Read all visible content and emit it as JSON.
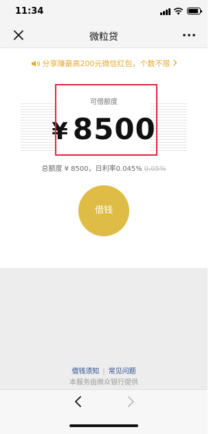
{
  "status_bar": {
    "time": "11:34"
  },
  "nav": {
    "title": "微粒贷",
    "close_icon": "close-icon",
    "more_icon": "more-dots-icon"
  },
  "promo": {
    "text": "分享赚最高200元微信红包，个数不限",
    "icon": "speaker-icon",
    "color": "#e3a92e"
  },
  "quota": {
    "label": "可借额度",
    "currency": "¥",
    "amount": "8500",
    "total_text": "总额度 ¥ 8500，日利率0.045%",
    "old_rate": "0.05%"
  },
  "borrow_button": {
    "label": "借钱",
    "color": "#dfbc45"
  },
  "footer": {
    "link_notice": "借钱须知",
    "link_faq": "常见问题",
    "provider": "本服务由微众银行提供"
  },
  "colors": {
    "highlight_border": "#e0243a",
    "link": "#2b4f8e"
  }
}
